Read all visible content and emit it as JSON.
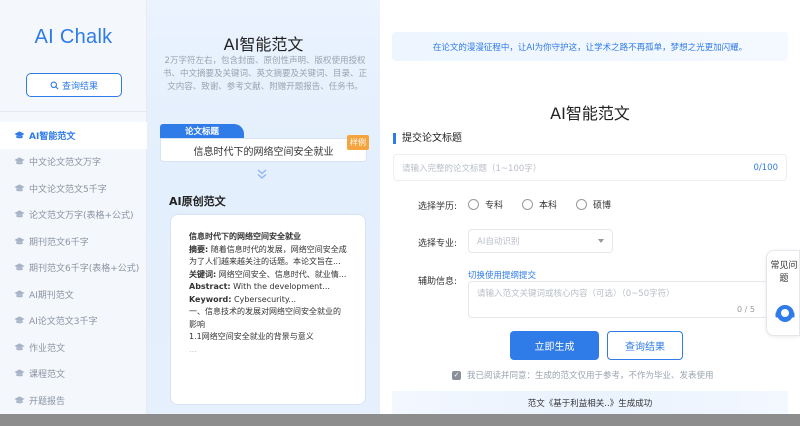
{
  "sidebar": {
    "logo": "AI Chalk",
    "query_button": "查询结果",
    "items": [
      {
        "label": "AI智能范文",
        "active": true
      },
      {
        "label": "中文论文范文万字"
      },
      {
        "label": "中文论文范文5千字"
      },
      {
        "label": "论文范文万字(表格+公式)"
      },
      {
        "label": "期刊范文6千字"
      },
      {
        "label": "期刊范文6千字(表格+公式)"
      },
      {
        "label": "AI期刊范文"
      },
      {
        "label": "AI论文范文3千字"
      },
      {
        "label": "作业范文"
      },
      {
        "label": "课程范文"
      },
      {
        "label": "开题报告"
      }
    ]
  },
  "middle": {
    "title": "AI智能范文",
    "description": "2万字符左右，包含封面、原创性声明、版权使用授权书、中文摘要及关键词、英文摘要及关键词、目录、正文内容、致谢、参考文献、附赠开题报告、任务书。",
    "paper_tag": "论文标题",
    "paper_title": "信息时代下的网络空间安全就业",
    "sample_badge": "样例",
    "original_title": "AI原创范文",
    "doc": {
      "heading": "信息时代下的网络空间安全就业",
      "abstract_label": "摘要:",
      "abstract_text": " 随着信息时代的发展，网络空间安全成为了人们越来越关注的话题。本论文旨在...",
      "keywords_label": "关键词:",
      "keywords_text": " 网络空间安全、信息时代、就业情...",
      "abstract_en_label": "Abstract:",
      "abstract_en_text": " With the development...",
      "keyword_en_label": "Keyword:",
      "keyword_en_text": " Cybersecurity...",
      "section1": "一、信息技术的发展对网络空间安全就业的影响",
      "section11": "1.1网络空间安全就业的背景与意义",
      "fade": "…"
    }
  },
  "right": {
    "banner": "在论文的漫漫征程中，让AI为你守护这，让学术之路不再孤单，梦想之光更加闪耀。",
    "form_title": "AI智能范文",
    "sub_title": "提交论文标题",
    "title_placeholder": "请输入完整的论文标题（1~100字）",
    "title_counter": "0/100",
    "education_label": "选择学历:",
    "education_options": [
      "专科",
      "本科",
      "硕博"
    ],
    "major_label": "选择专业:",
    "major_placeholder": "AI自动识别",
    "aux_label": "辅助信息:",
    "aux_link": "切换使用提纲提交",
    "aux_placeholder": "请输入范文关键词或核心内容（可选）（0~50字符）",
    "aux_counter": "0 / 5",
    "generate_button": "立即生成",
    "query_button": "查询结果",
    "agree_text": "我已阅读并同意：生成的范文仅用于参考，不作为毕业、发表使用",
    "success_text": "范文《基于利益相关..》生成成功"
  },
  "help": {
    "label": "常见问题"
  },
  "colors": {
    "accent": "#2f7be8",
    "badge": "#f6a43d"
  }
}
